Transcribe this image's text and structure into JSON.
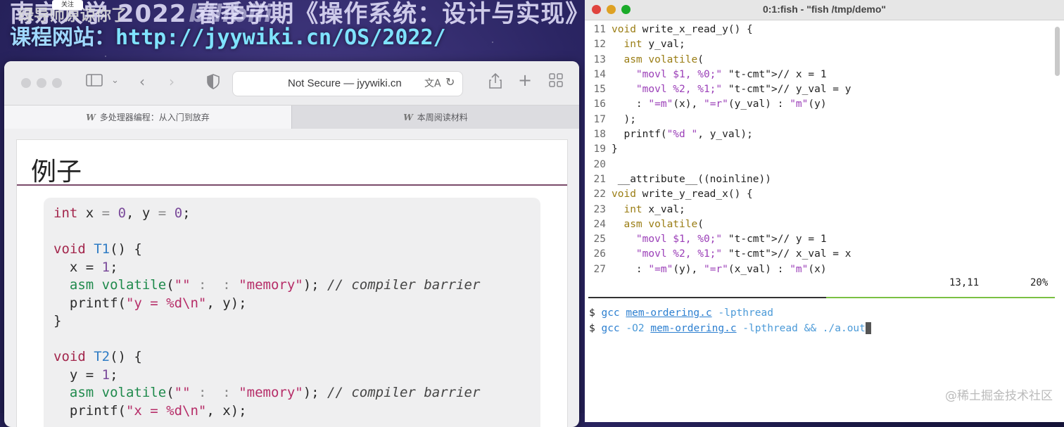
{
  "banner": {
    "line1": "南京大学 2022 春季学期《操作系统：设计与实现》",
    "line2_label": "课程网站：",
    "line2_url": "http://jyywiki.cn/OS/2022/",
    "overlay": "绿导师原谅你了",
    "bili": "bilibili",
    "mini_badge": "关注"
  },
  "browser": {
    "address": "Not Secure — jyywiki.cn",
    "tabs": [
      {
        "icon": "W",
        "label": "多处理器编程：从入门到放弃"
      },
      {
        "icon": "W",
        "label": "本周阅读材料"
      }
    ],
    "page_title": "例子",
    "code": {
      "l1": [
        "int",
        " x ",
        "=",
        " ",
        "0",
        ", y ",
        "=",
        " ",
        "0",
        ";"
      ],
      "t1_fn": "T1",
      "t2_fn": "T2",
      "void": "void",
      "x_assign": "x = ",
      "y_assign": "y = ",
      "one": "1",
      "asm": "asm",
      "volatile": "volatile",
      "empty_str": "\"\"",
      "colons": ":  :",
      "memory": "\"memory\"",
      "comment": "// compiler barrier",
      "printf": "printf",
      "fmt_y": "\"y = %d\\n\"",
      "fmt_x": "\"x = %d\\n\""
    }
  },
  "terminal": {
    "title": "0:1:fish - \"fish /tmp/demo\"",
    "lines": [
      {
        "n": "11",
        "text": "void write_x_read_y() {"
      },
      {
        "n": "12",
        "text": "  int y_val;"
      },
      {
        "n": "13",
        "text": "  asm volatile("
      },
      {
        "n": "14",
        "text": "    \"movl $1, %0;\" // x = 1"
      },
      {
        "n": "15",
        "text": "    \"movl %2, %1;\" // y_val = y"
      },
      {
        "n": "16",
        "text": "    : \"=m\"(x), \"=r\"(y_val) : \"m\"(y)"
      },
      {
        "n": "17",
        "text": "  );"
      },
      {
        "n": "18",
        "text": "  printf(\"%d \", y_val);"
      },
      {
        "n": "19",
        "text": "}"
      },
      {
        "n": "20",
        "text": ""
      },
      {
        "n": "21",
        "text": " __attribute__((noinline))"
      },
      {
        "n": "22",
        "text": "void write_y_read_x() {"
      },
      {
        "n": "23",
        "text": "  int x_val;"
      },
      {
        "n": "24",
        "text": "  asm volatile("
      },
      {
        "n": "25",
        "text": "    \"movl $1, %0;\" // y = 1"
      },
      {
        "n": "26",
        "text": "    \"movl %2, %1;\" // x_val = x"
      },
      {
        "n": "27",
        "text": "    : \"=m\"(y), \"=r\"(x_val) : \"m\"(x)"
      }
    ],
    "status_pos": "13,11",
    "status_pct": "20%",
    "shell": {
      "prompt": "$",
      "cmd1": {
        "gcc": "gcc",
        "file": "mem-ordering.c",
        "rest": "-lpthread"
      },
      "cmd2": {
        "gcc": "gcc",
        "opt": "-O2",
        "file": "mem-ordering.c",
        "rest": "-lpthread && ./a.out"
      }
    }
  },
  "watermark": "@稀土掘金技术社区"
}
